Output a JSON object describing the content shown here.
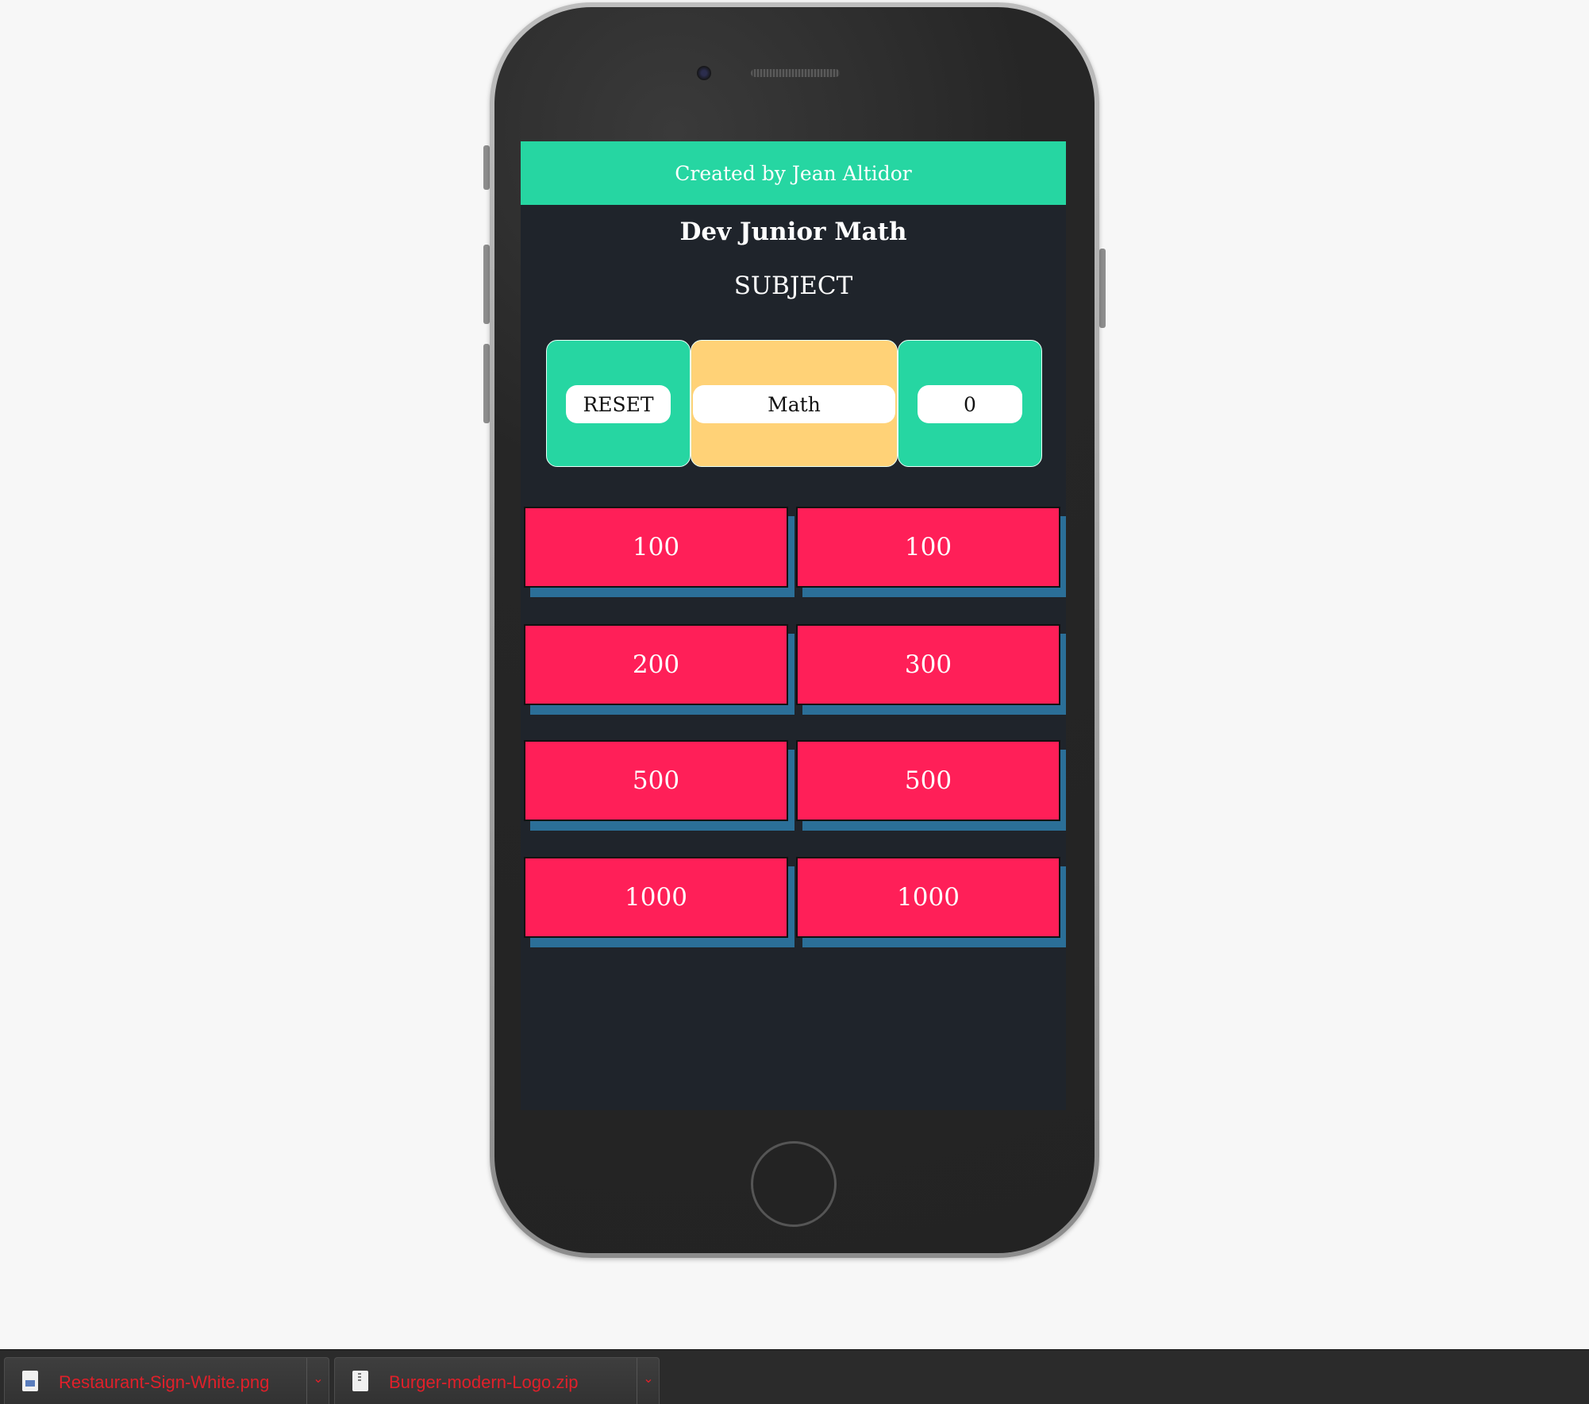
{
  "banner": {
    "text": "Created by Jean Altidor",
    "icon": "apple-icon"
  },
  "app": {
    "title": "Dev Junior Math",
    "subject_label": "SUBJECT"
  },
  "controls": {
    "reset_label": "RESET",
    "subject_value": "Math",
    "score": "0"
  },
  "tiles": [
    "100",
    "100",
    "200",
    "300",
    "500",
    "500",
    "1000",
    "1000"
  ],
  "colors": {
    "banner": "#26d6a2",
    "panel_green": "#26d6a2",
    "panel_yellow": "#ffd277",
    "tile": "#ff1f58",
    "tile_shadow": "#2b6f98",
    "screen_bg": "#1f242b"
  },
  "downloads": [
    {
      "name": "Restaurant-Sign-White.png",
      "icon": "image-file-icon"
    },
    {
      "name": "Burger-modern-Logo.zip",
      "icon": "zip-file-icon"
    }
  ]
}
